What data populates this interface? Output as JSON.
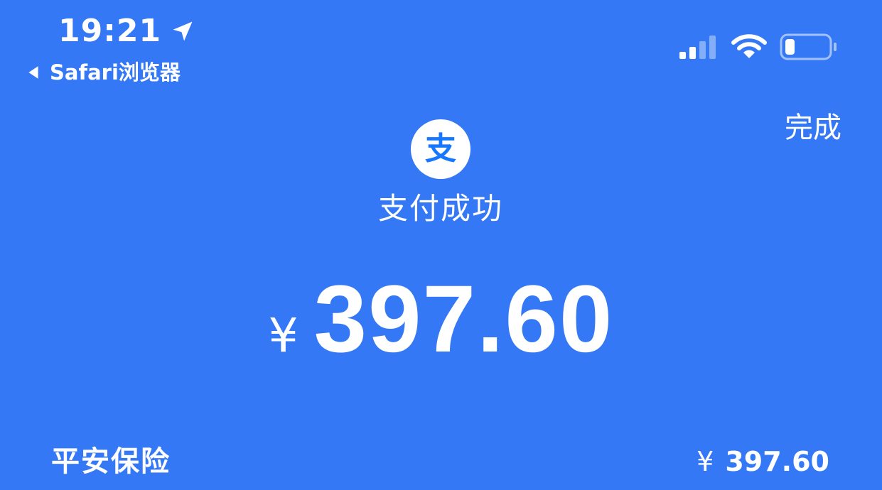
{
  "status_bar": {
    "time": "19:21",
    "back_app_label": "Safari浏览器"
  },
  "header": {
    "done_label": "完成"
  },
  "logo": {
    "glyph": "支"
  },
  "payment": {
    "status_text": "支付成功",
    "currency_symbol": "¥",
    "amount": "397.60"
  },
  "merchant": {
    "name": "平安保险",
    "currency_symbol": "¥",
    "amount": "397.60"
  },
  "colors": {
    "background": "#3478f6",
    "logo_background": "#ffffff",
    "logo_glyph": "#1677ff",
    "text": "#ffffff"
  },
  "icons": [
    "location-arrow-icon",
    "back-arrow-icon",
    "signal-icon",
    "wifi-icon",
    "battery-icon",
    "alipay-logo-icon"
  ]
}
